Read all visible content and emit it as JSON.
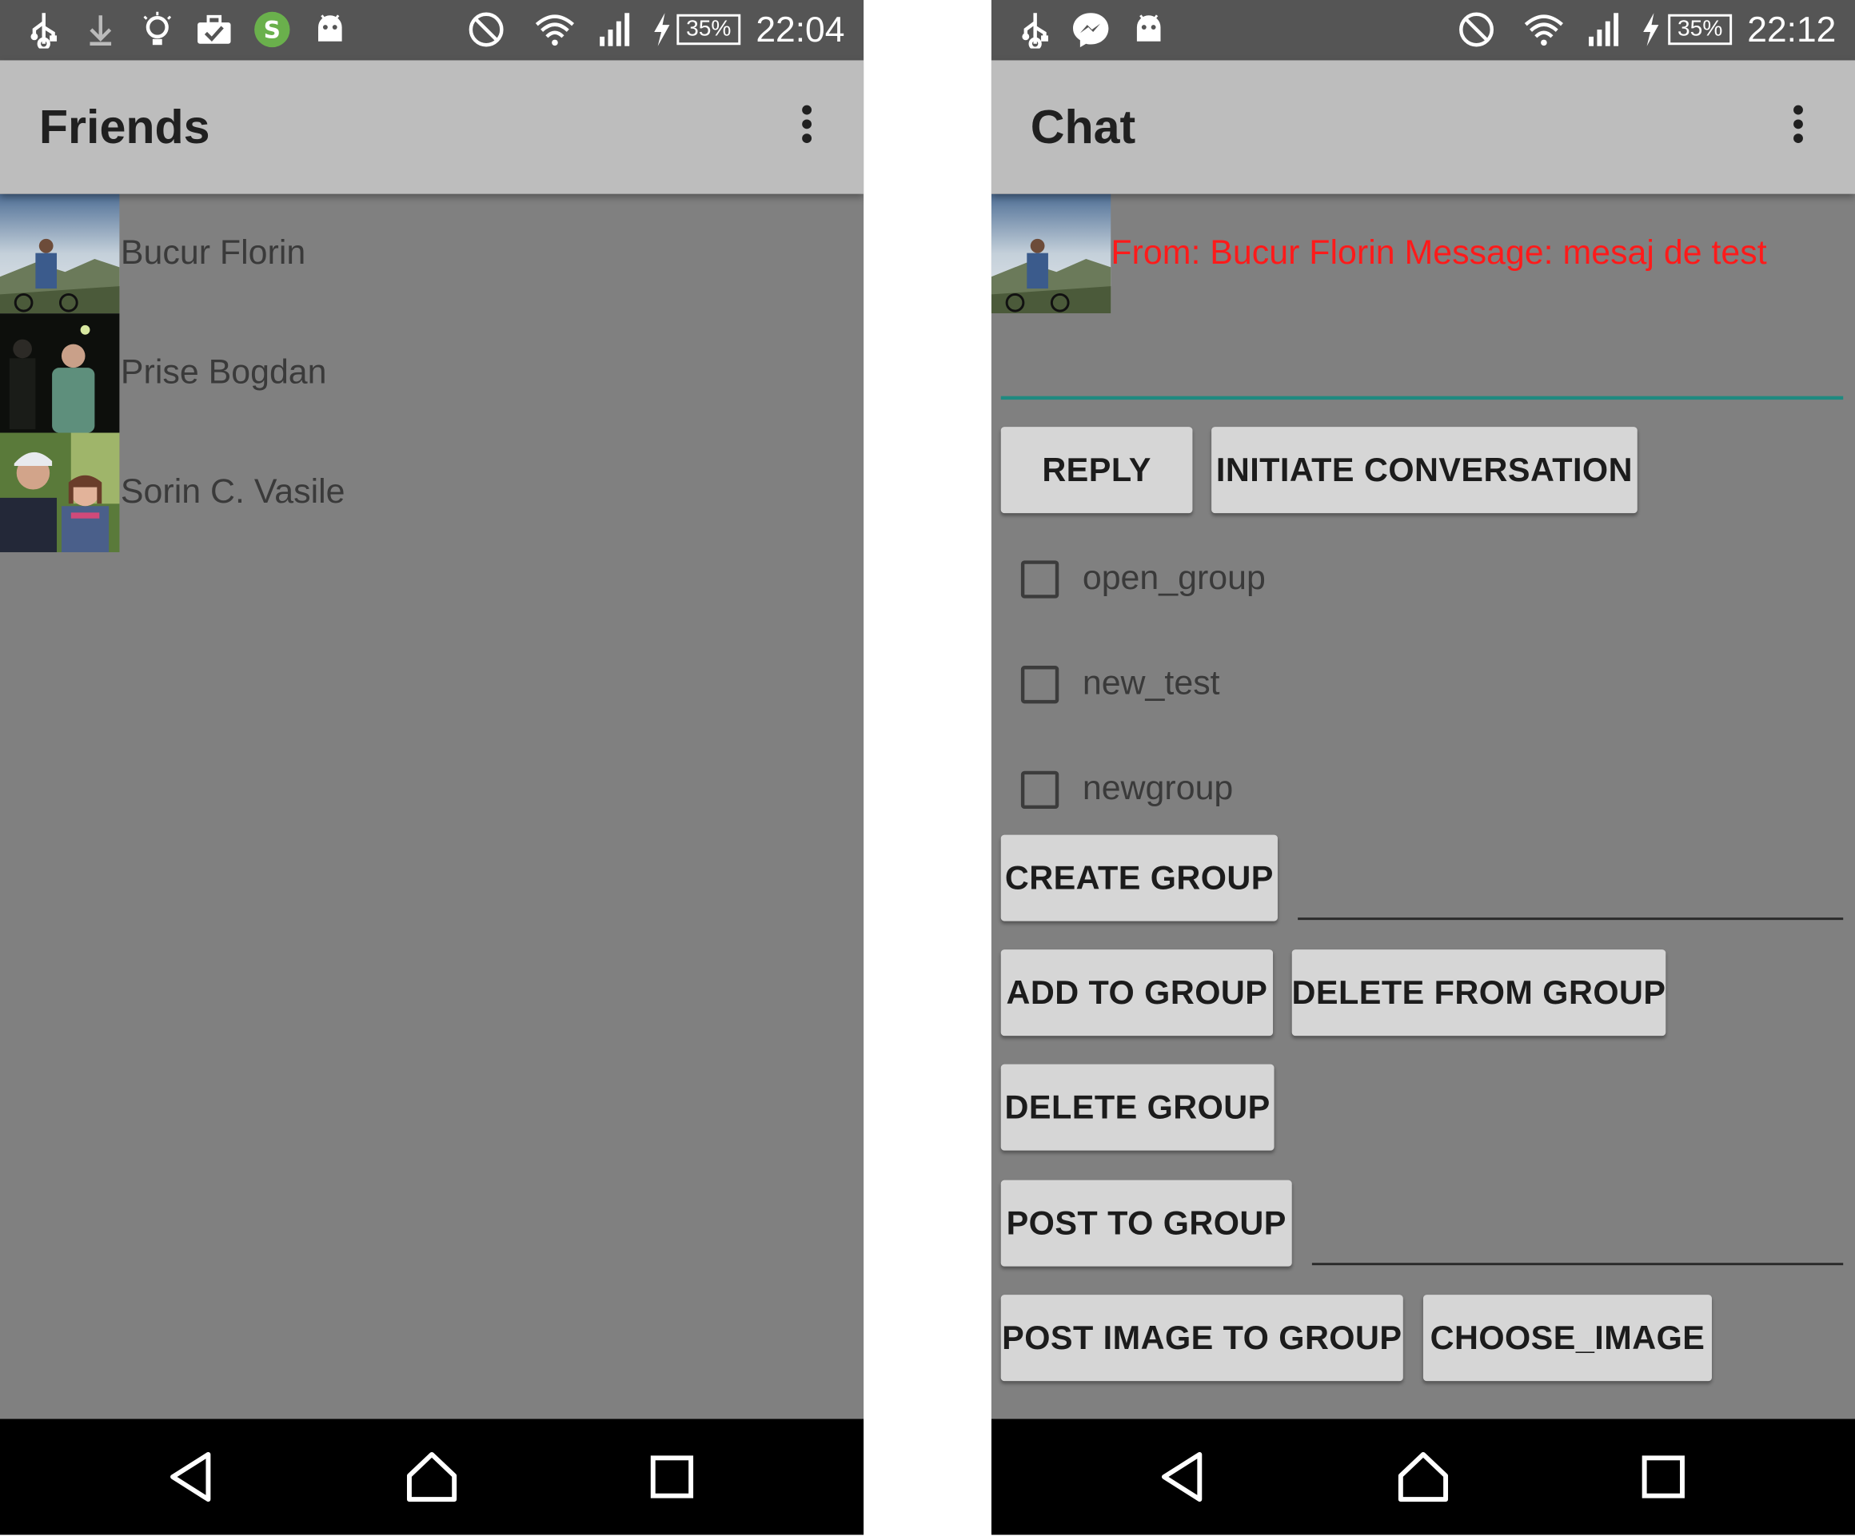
{
  "left_screen": {
    "status": {
      "time": "22:04",
      "battery": "35%",
      "icons": [
        "usb-icon",
        "download-icon",
        "bulb-icon",
        "briefcase-check-icon",
        "shazam-icon",
        "android-icon",
        "block-icon",
        "wifi-icon",
        "signal-icon",
        "charging-icon"
      ]
    },
    "appbar": {
      "title": "Friends",
      "menu_icon": "more-vert-icon"
    },
    "friends": [
      {
        "name": "Bucur Florin"
      },
      {
        "name": "Prise Bogdan"
      },
      {
        "name": "Sorin C. Vasile"
      }
    ],
    "nav": [
      "back-icon",
      "home-icon",
      "recents-icon"
    ]
  },
  "right_screen": {
    "status": {
      "time": "22:12",
      "battery": "35%",
      "icons": [
        "usb-icon",
        "messenger-icon",
        "android-icon",
        "block-icon",
        "wifi-icon",
        "signal-icon",
        "charging-icon"
      ]
    },
    "appbar": {
      "title": "Chat",
      "menu_icon": "more-vert-icon"
    },
    "message": {
      "text": "From: Bucur Florin Message: mesaj de test"
    },
    "buttons": {
      "reply": "REPLY",
      "initiate": "INITIATE CONVERSATION",
      "create_group": "CREATE GROUP",
      "add_to_group": "ADD TO GROUP",
      "delete_from_group": "DELETE FROM GROUP",
      "delete_group": "DELETE GROUP",
      "post_to_group": "POST TO GROUP",
      "post_image_to_group": "POST IMAGE TO GROUP",
      "choose_image": "CHOOSE_IMAGE"
    },
    "groups": [
      {
        "label": "open_group",
        "checked": false
      },
      {
        "label": "new_test",
        "checked": false
      },
      {
        "label": "newgroup",
        "checked": false
      }
    ],
    "nav": [
      "back-icon",
      "home-icon",
      "recents-icon"
    ]
  },
  "colors": {
    "content_bg": "#808080",
    "appbar_bg": "#bdbdbd",
    "statusbar_bg": "#555555",
    "message_text": "#ff1a1a",
    "edit_focus": "#1f8a80",
    "button_bg": "#d6d6d6"
  }
}
